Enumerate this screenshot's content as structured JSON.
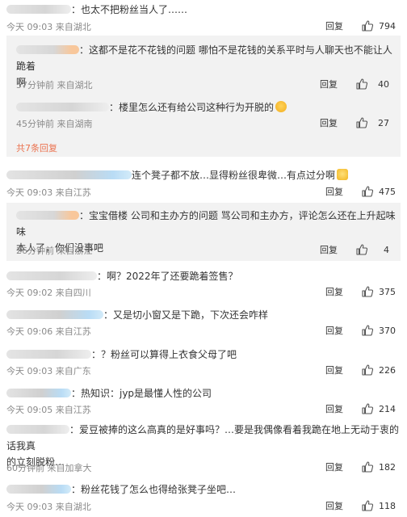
{
  "common": {
    "reply_label": "回复"
  },
  "comments": [
    {
      "text": "：也太不把粉丝当人了……",
      "meta": "今天 09:03 来自湖北",
      "likes": "794"
    },
    {
      "text": "连个凳子都不放…显得粉丝很卑微…有点过分啊",
      "meta": "今天 09:03 来自江苏",
      "likes": "475"
    },
    {
      "text": "：啊？2022年了还要跪着签售？",
      "meta": "今天 09:02 来自四川",
      "likes": "375"
    },
    {
      "text": "：又是切小窗又是下跪，下次还会咋样",
      "meta": "今天 09:06 来自江苏",
      "likes": "370"
    },
    {
      "text": "：？粉丝可以算得上衣食父母了吧",
      "meta": "今天 09:03 来自广东",
      "likes": "226"
    },
    {
      "text": "：热知识：jyp是最懂人性的公司",
      "meta": "今天 09:05 来自江苏",
      "likes": "214"
    },
    {
      "line1": "：爱豆被捧的这么高真的是好事吗？…要是我偶像看着我跪在地上无动于衷的话我真",
      "line2": "的立刻脱粉…",
      "meta": "60分钟前 来自加拿大",
      "likes": "182"
    },
    {
      "text": "：粉丝花钱了怎么也得给张凳子坐吧…",
      "meta": "今天 09:03 来自湖北",
      "likes": "118"
    }
  ],
  "replies": [
    {
      "line1": "：这都不是花不花钱的问题 哪怕不是花钱的关系平时与人聊天也不能让人跪着",
      "line2": "啊",
      "meta": "57分钟前 来自湖北",
      "likes": "40"
    },
    {
      "text": "：楼里怎么还有给公司这种行为开脱的",
      "meta": "45分钟前 来自湖南",
      "likes": "27"
    },
    {
      "line1": "：宝宝借楼 公司和主办方的问题 骂公司和主办方，评论怎么还在上升起味味",
      "line2": "本人了，你们没事吧",
      "meta": "26分钟前 来自浙江",
      "likes": "4"
    }
  ],
  "more_replies": "共7条回复",
  "icons": {
    "like": "thumbs-up-icon",
    "emoji_cry": "crying-face-emoji",
    "emoji_sweat": "sweat-face-emoji"
  },
  "colors": {
    "link": "#eb7350",
    "meta": "#8a8a8a",
    "reply_bg": "#f2f2f2"
  }
}
